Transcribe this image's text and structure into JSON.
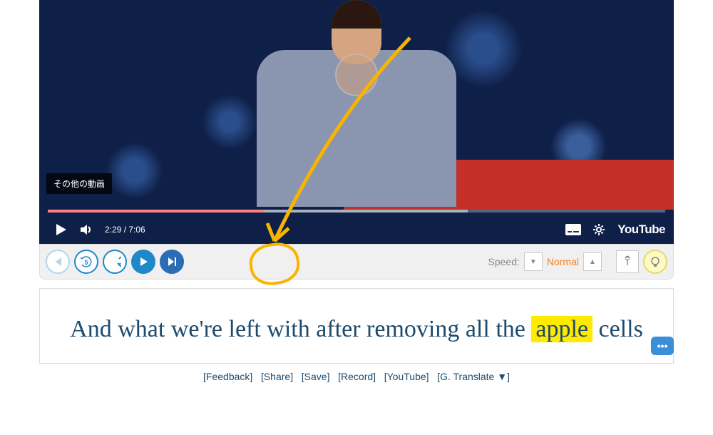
{
  "video": {
    "overlay_label": "その他の動画",
    "time_current": "2:29",
    "time_total": "7:06",
    "logo": "YouTube"
  },
  "controls": {
    "speed_label": "Speed:",
    "speed_value": "Normal"
  },
  "subtitle": {
    "part1": "And what we're left with after removing all the ",
    "highlight": "apple",
    "part2": " cells"
  },
  "links": {
    "feedback": "[Feedback]",
    "share": "[Share]",
    "save": "[Save]",
    "record": "[Record]",
    "youtube": "[YouTube]",
    "translate": "[G. Translate  ▼]"
  },
  "chat": "•••"
}
